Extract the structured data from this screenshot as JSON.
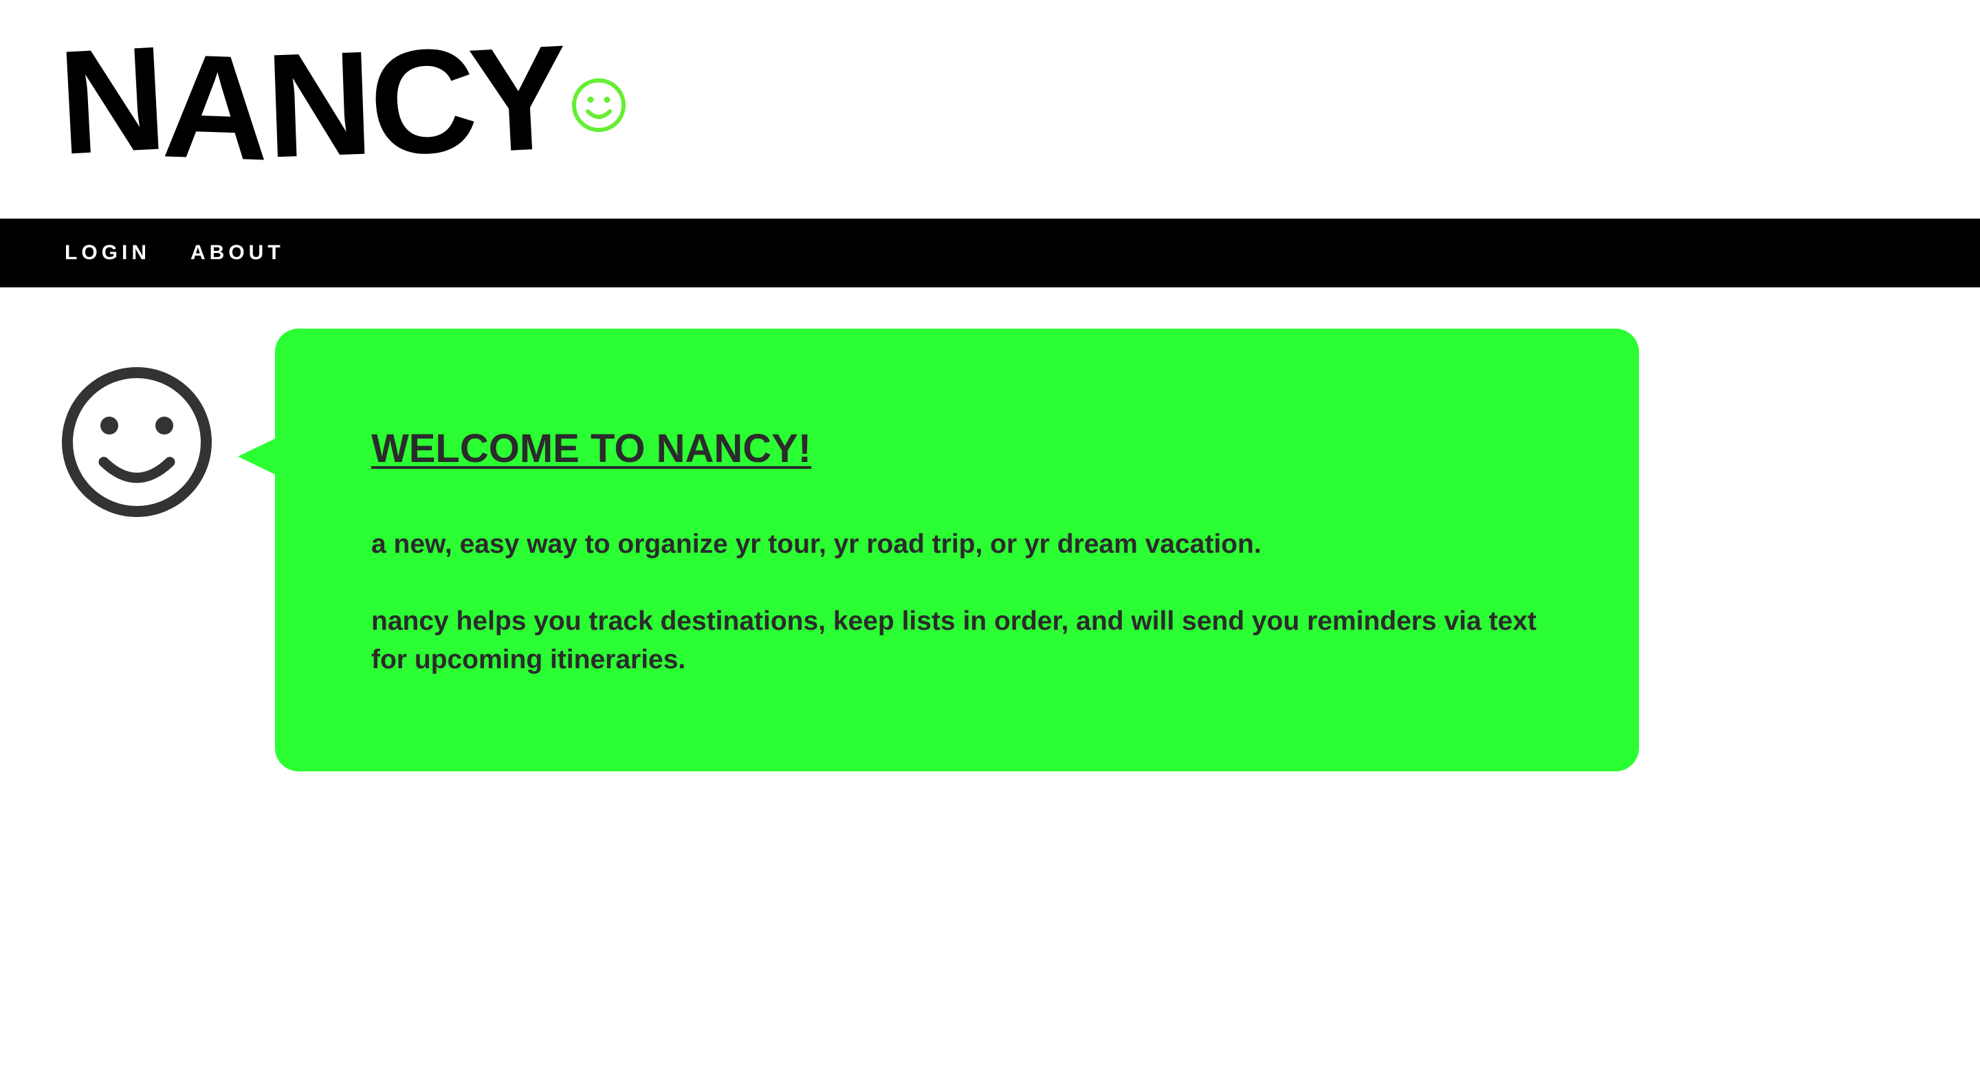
{
  "theme": {
    "accent": "#2bff33",
    "logo_icon_color": "#66ee33",
    "text_dark": "#2b2b2b",
    "nav_bg": "#000000",
    "nav_text": "#ffffff"
  },
  "header": {
    "logo_letters": [
      "N",
      "A",
      "N",
      "C",
      "Y"
    ],
    "logo_icon": "smiley-icon"
  },
  "nav": {
    "items": [
      {
        "label": "LOGIN"
      },
      {
        "label": "ABOUT"
      }
    ]
  },
  "main": {
    "avatar_icon": "smiley-face-icon",
    "welcome": {
      "title": "WELCOME TO NANCY!",
      "paragraphs": [
        "a new, easy way to organize yr tour, yr road trip, or yr dream vacation.",
        "nancy helps you track destinations, keep lists in order, and will send you reminders via text for upcoming itineraries."
      ]
    }
  }
}
